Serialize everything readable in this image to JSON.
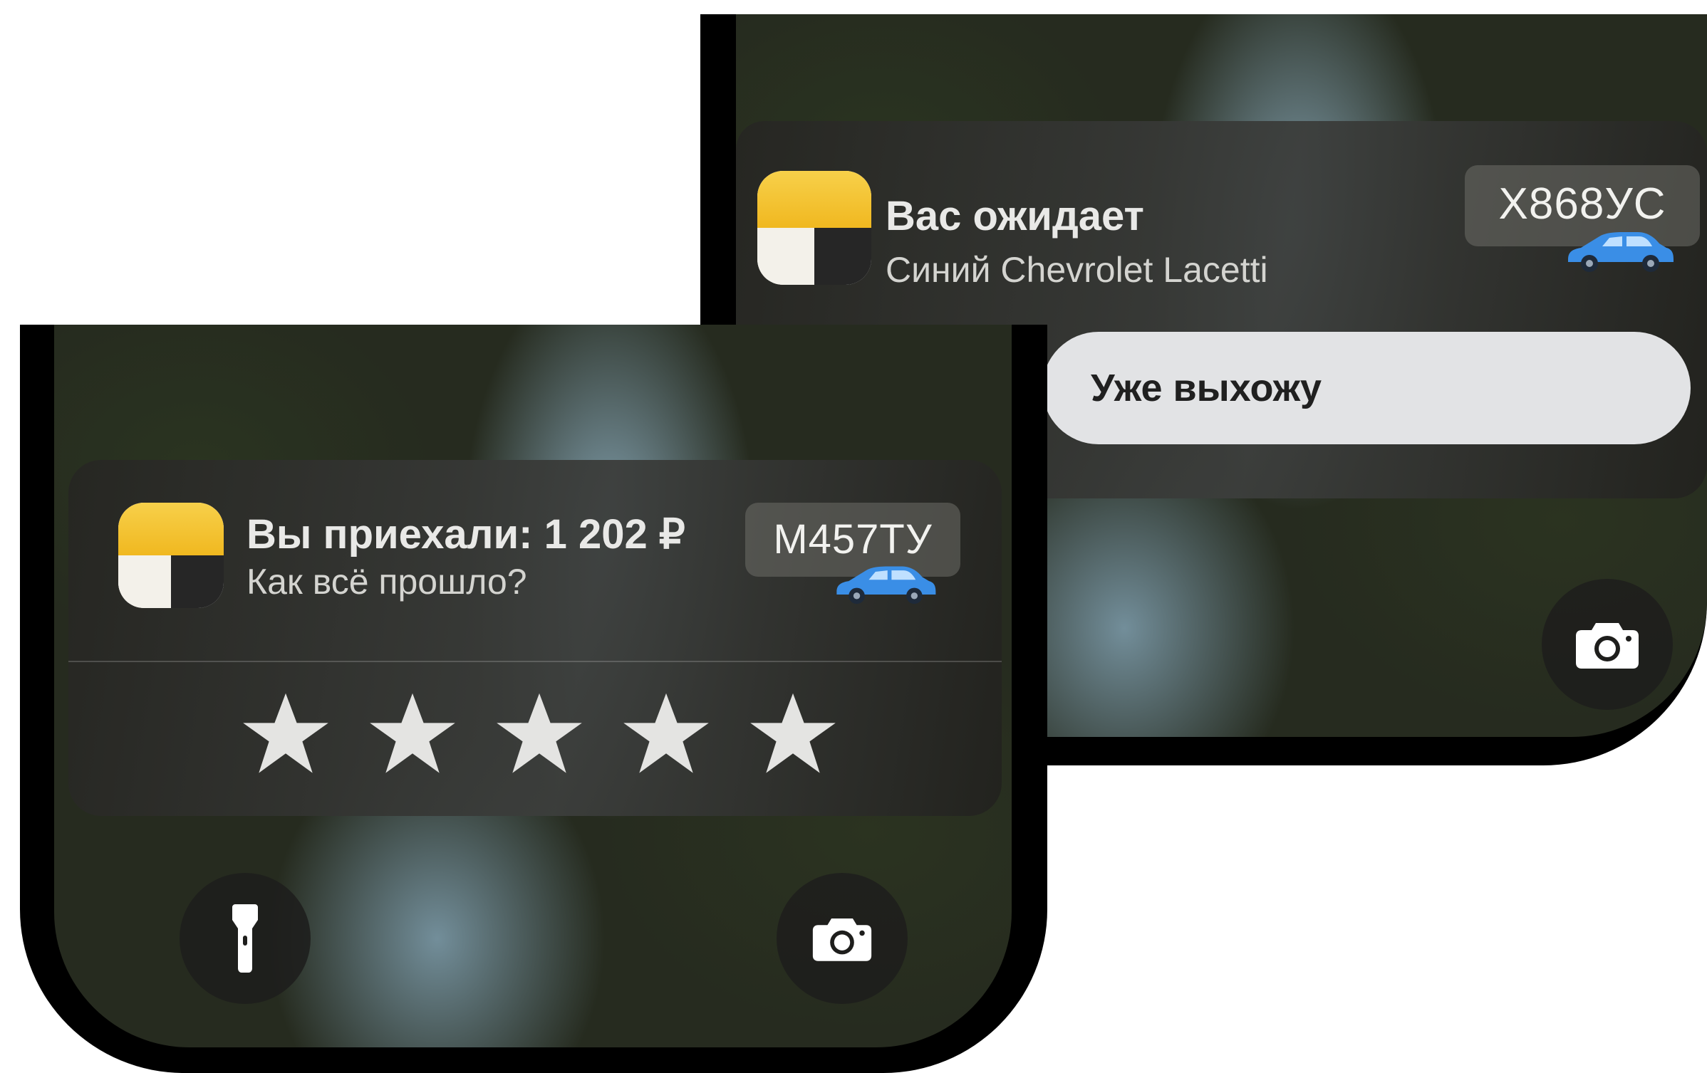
{
  "back_screen": {
    "notification": {
      "title": "Вас ожидает",
      "subtitle": "Синий Chevrolet Lacetti",
      "plate": "Х868УС",
      "app_icon": "taxi-app-icon",
      "car_icon": "blue-car-icon"
    },
    "action_button": "Уже выхожу",
    "camera_icon": "camera-icon"
  },
  "front_screen": {
    "notification": {
      "title": "Вы приехали: 1 202 ₽",
      "subtitle": "Как всё прошло?",
      "plate": "М457ТУ",
      "app_icon": "taxi-app-icon",
      "car_icon": "blue-car-icon"
    },
    "rating": {
      "max": 5,
      "icon": "star-icon"
    },
    "flashlight_icon": "flashlight-icon",
    "camera_icon": "camera-icon"
  },
  "colors": {
    "brand_yellow": "#f0b820",
    "car_blue": "#3a8ee6",
    "card_bg": "#2a2a26",
    "button_light": "#e2e3e5"
  }
}
